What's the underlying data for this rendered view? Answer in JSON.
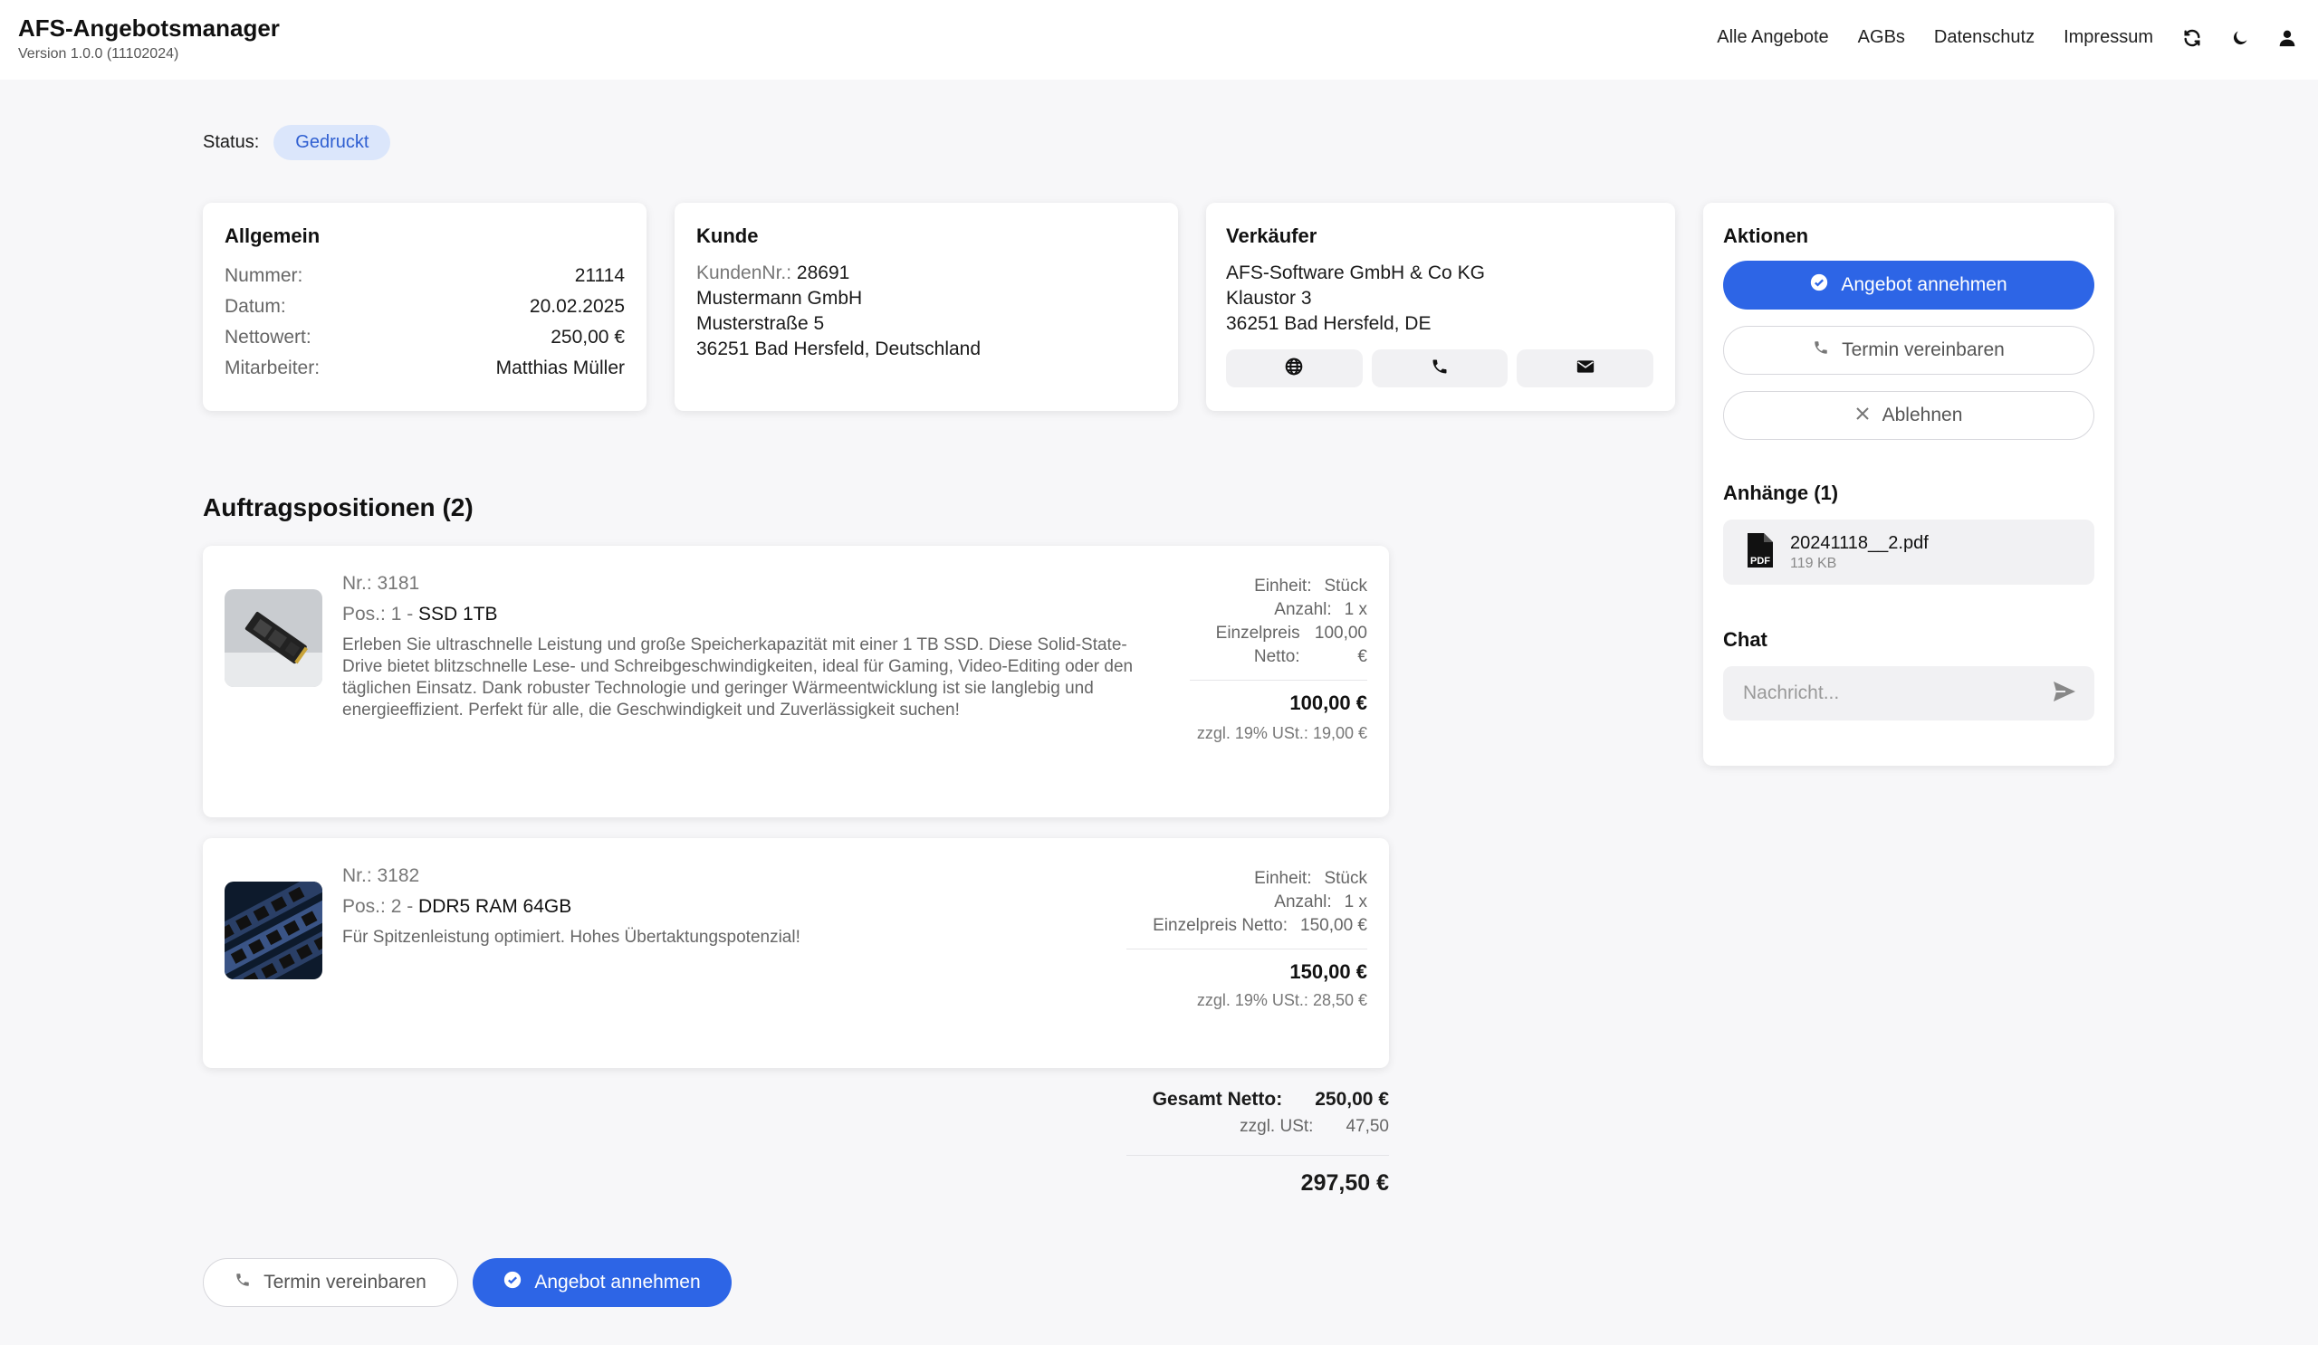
{
  "app": {
    "title": "AFS-Angebotsmanager",
    "version": "Version 1.0.0 (11102024)"
  },
  "nav": {
    "items": [
      "Alle Angebote",
      "AGBs",
      "Datenschutz",
      "Impressum"
    ],
    "icons": [
      "refresh-icon",
      "moon-icon",
      "user-icon"
    ]
  },
  "status": {
    "label": "Status:",
    "value": "Gedruckt"
  },
  "general": {
    "title": "Allgemein",
    "rows": [
      {
        "k": "Nummer:",
        "v": "21114"
      },
      {
        "k": "Datum:",
        "v": "20.02.2025"
      },
      {
        "k": "Nettowert:",
        "v": "250,00 €"
      },
      {
        "k": "Mitarbeiter:",
        "v": "Matthias Müller"
      }
    ]
  },
  "customer": {
    "title": "Kunde",
    "number_label": "KundenNr.:",
    "number": "28691",
    "name": "Mustermann GmbH",
    "street": "Musterstraße 5",
    "city": "36251 Bad Hersfeld, Deutschland"
  },
  "seller": {
    "title": "Verkäufer",
    "name": "AFS-Software GmbH & Co KG",
    "street": "Klaustor 3",
    "city": "36251 Bad Hersfeld, DE",
    "icons": [
      "globe-icon",
      "phone-icon",
      "mail-icon"
    ]
  },
  "actions": {
    "title": "Aktionen",
    "accept": "Angebot annehmen",
    "appointment": "Termin vereinbaren",
    "decline": "Ablehnen"
  },
  "attachments": {
    "title": "Anhänge (1)",
    "file": {
      "name": "20241118__2.pdf",
      "size": "119 KB"
    }
  },
  "chat": {
    "title": "Chat",
    "placeholder": "Nachricht..."
  },
  "positions": {
    "title": "Auftragspositionen (2)",
    "items": [
      {
        "nr": "Nr.: 3181",
        "pos_prefix": "Pos.: 1 - ",
        "name": "SSD 1TB",
        "desc": "Erleben Sie ultraschnelle Leistung und große Speicherkapazität mit einer 1 TB SSD. Diese Solid-State-Drive bietet blitzschnelle Lese- und Schreibgeschwindigkeiten, ideal für Gaming, Video-Editing oder den täglichen Einsatz. Dank robuster Technologie und geringer Wärmeentwicklung ist sie langlebig und energieeffizient. Perfekt für alle, die Geschwindigkeit und Zuverlässigkeit suchen!",
        "unit_label": "Einheit:",
        "unit": "Stück",
        "qty_label": "Anzahl:",
        "qty": "1 x",
        "price_label": "Einzelpreis Netto:",
        "price": "100,00 €",
        "total": "100,00 €",
        "tax": "zzgl. 19% USt.: 19,00 €"
      },
      {
        "nr": "Nr.: 3182",
        "pos_prefix": "Pos.: 2 - ",
        "name": "DDR5 RAM 64GB",
        "desc": "Für Spitzenleistung optimiert. Hohes Übertaktungspotenzial!",
        "unit_label": "Einheit:",
        "unit": "Stück",
        "qty_label": "Anzahl:",
        "qty": "1 x",
        "price_label": "Einzelpreis Netto:",
        "price": "150,00 €",
        "total": "150,00 €",
        "tax": "zzgl. 19% USt.: 28,50 €"
      }
    ]
  },
  "summary": {
    "net_label": "Gesamt Netto:",
    "net": "250,00 €",
    "tax_label": "zzgl. USt:",
    "tax": "47,50",
    "total": "297,50 €"
  },
  "footer": {
    "appointment": "Termin vereinbaren",
    "accept": "Angebot annehmen"
  },
  "colors": {
    "primary": "#2d65e6",
    "badge_bg": "#dbe6fb",
    "badge_text": "#2f5fd1"
  }
}
